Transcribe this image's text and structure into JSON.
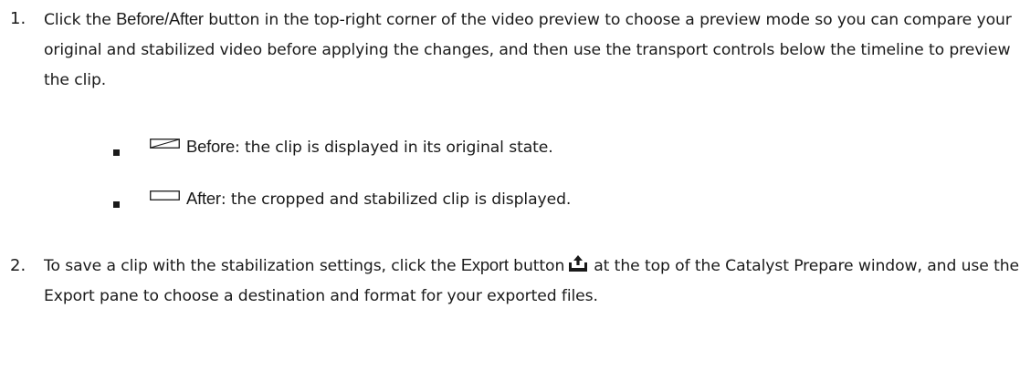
{
  "steps": [
    {
      "number": "1.",
      "parts": [
        "Click the ",
        "Before/After",
        " button in the top-right corner of the video preview to choose a preview mode so you can compare your original and stabilized video before applying the changes, and then use the transport controls below the timeline to preview the clip."
      ]
    },
    {
      "number": "2.",
      "parts": [
        "To save a clip with the stabilization settings, click the ",
        "Export",
        " button",
        "at the top of the Catalyst Prepare window, and use the Export pane to choose a destination and format for your exported files."
      ]
    }
  ],
  "bullets": [
    {
      "icon": "before-mode-icon",
      "label": "Before",
      "text": ": the clip is displayed in its original state."
    },
    {
      "icon": "after-mode-icon",
      "label": "After",
      "text": ": the cropped and stabilized clip is displayed."
    }
  ],
  "icons": {
    "export": "export-icon",
    "export_color": "#1a1a1a"
  }
}
